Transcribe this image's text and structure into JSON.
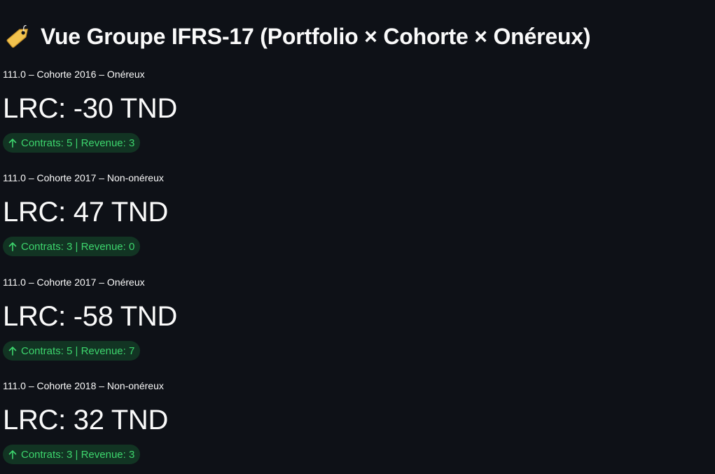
{
  "header": {
    "icon": "label-tag-icon",
    "title": "Vue Groupe IFRS-17 (Portfolio × Cohorte × Onéreux)"
  },
  "colors": {
    "background": "#0e1117",
    "text": "#fafafa",
    "delta_positive_text": "#3dd56d",
    "delta_positive_bg": "#1c3a28",
    "tag_icon": "#f2c34e"
  },
  "metrics": [
    {
      "label": "111.0 – Cohorte 2016 – Onéreux",
      "value": "LRC: -30 TND",
      "delta_icon": "arrow-up-icon",
      "delta": "Contrats: 5 | Revenue: 3"
    },
    {
      "label": "111.0 – Cohorte 2017 – Non-onéreux",
      "value": "LRC: 47 TND",
      "delta_icon": "arrow-up-icon",
      "delta": "Contrats: 3 | Revenue: 0"
    },
    {
      "label": "111.0 – Cohorte 2017 – Onéreux",
      "value": "LRC: -58 TND",
      "delta_icon": "arrow-up-icon",
      "delta": "Contrats: 5 | Revenue: 7"
    },
    {
      "label": "111.0 – Cohorte 2018 – Non-onéreux",
      "value": "LRC: 32 TND",
      "delta_icon": "arrow-up-icon",
      "delta": "Contrats: 3 | Revenue: 3"
    }
  ]
}
